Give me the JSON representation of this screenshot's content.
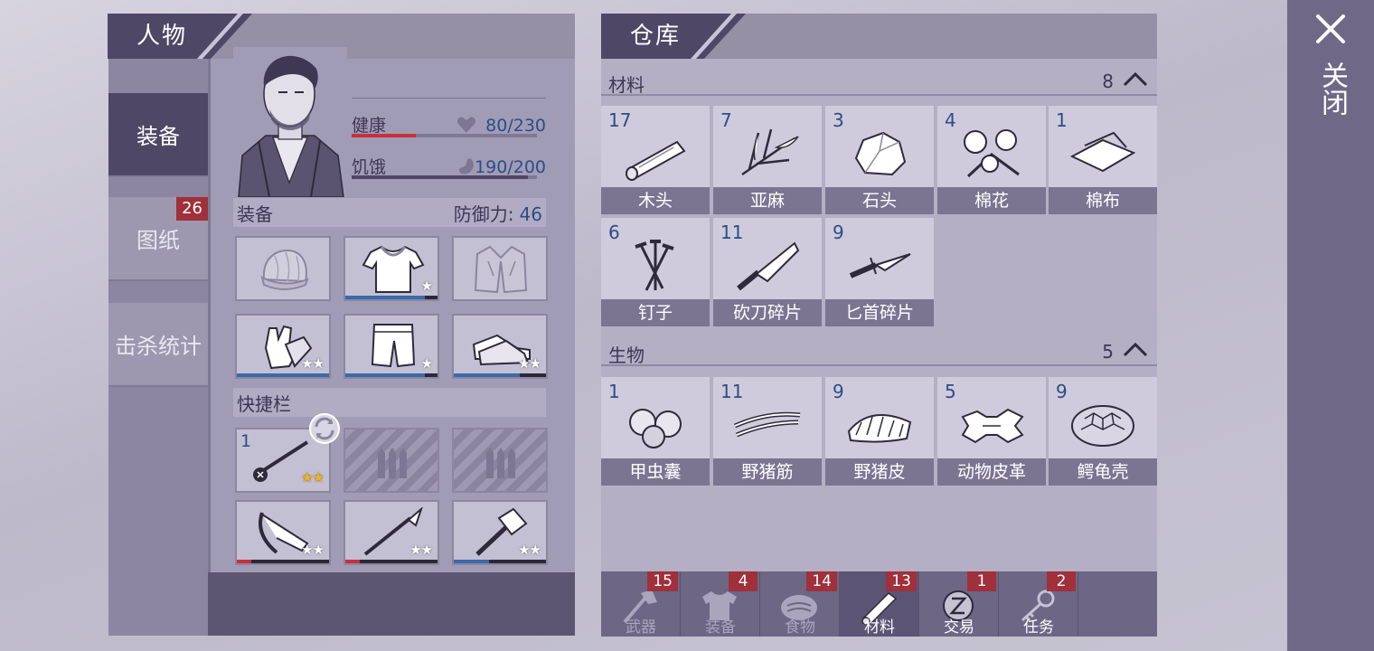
{
  "close": {
    "label": "关闭",
    "icon": "close-icon"
  },
  "character": {
    "title": "人物",
    "side_tabs": [
      {
        "label": "装备",
        "active": true
      },
      {
        "label": "图纸",
        "badge": "26"
      },
      {
        "label": "击杀统计"
      }
    ],
    "stats": {
      "health": {
        "label": "健康",
        "value": "80/230",
        "fraction": 0.348,
        "color": "#c8303a",
        "icon": "heart-icon"
      },
      "hunger": {
        "label": "饥饿",
        "value": "190/200",
        "fraction": 0.95,
        "color": "#4e4766",
        "icon": "stomach-icon"
      }
    },
    "equipment": {
      "label": "装备",
      "defense_label": "防御力:",
      "defense_value": "46",
      "slots": [
        {
          "icon": "beanie-hat-icon",
          "stars": "",
          "durability": null
        },
        {
          "icon": "shirt-icon",
          "stars": "★",
          "durability": 0.86
        },
        {
          "icon": "jacket-icon",
          "stars": "",
          "durability": null
        },
        {
          "icon": "gloves-icon",
          "stars": "★★",
          "durability": 1.0
        },
        {
          "icon": "pants-icon",
          "stars": "★",
          "durability": 0.86
        },
        {
          "icon": "sneakers-icon",
          "stars": "★★",
          "durability": 0.72
        }
      ]
    },
    "quickbar": {
      "label": "快捷栏",
      "slots": [
        {
          "qty": "1",
          "icon": "flail-weapon-icon",
          "stars": "★★",
          "locked": false
        },
        {
          "icon": "locked-slot-icon",
          "locked": true
        },
        {
          "icon": "locked-slot-icon",
          "locked": true
        },
        {
          "icon": "crossbow-icon",
          "stars": "★★",
          "durability": 0.16,
          "dur_color": "#c8303a"
        },
        {
          "icon": "spear-icon",
          "stars": "★★",
          "durability": 0.16,
          "dur_color": "#c8303a"
        },
        {
          "icon": "sledgehammer-icon",
          "stars": "★★",
          "durability": 0.38
        }
      ]
    }
  },
  "storage": {
    "title": "仓库",
    "categories": [
      {
        "label": "材料",
        "count": "8",
        "items": [
          {
            "qty": "17",
            "name": "木头",
            "icon": "wood-log-icon"
          },
          {
            "qty": "7",
            "name": "亚麻",
            "icon": "flax-icon"
          },
          {
            "qty": "3",
            "name": "石头",
            "icon": "stone-icon"
          },
          {
            "qty": "4",
            "name": "棉花",
            "icon": "cotton-icon"
          },
          {
            "qty": "1",
            "name": "棉布",
            "icon": "cloth-icon"
          },
          {
            "qty": "6",
            "name": "钉子",
            "icon": "nails-icon"
          },
          {
            "qty": "11",
            "name": "砍刀碎片",
            "icon": "machete-fragment-icon"
          },
          {
            "qty": "9",
            "name": "匕首碎片",
            "icon": "dagger-fragment-icon"
          }
        ]
      },
      {
        "label": "生物",
        "count": "5",
        "items": [
          {
            "qty": "1",
            "name": "甲虫囊",
            "icon": "beetle-sac-icon"
          },
          {
            "qty": "11",
            "name": "野猪筋",
            "icon": "boar-sinew-icon"
          },
          {
            "qty": "9",
            "name": "野猪皮",
            "icon": "boar-hide-icon"
          },
          {
            "qty": "5",
            "name": "动物皮革",
            "icon": "leather-icon"
          },
          {
            "qty": "9",
            "name": "鳄龟壳",
            "icon": "turtle-shell-icon"
          }
        ]
      }
    ],
    "bottom_tabs": [
      {
        "label": "武器",
        "badge": "15",
        "icon": "axe-icon"
      },
      {
        "label": "装备",
        "badge": "4",
        "icon": "shirt-icon"
      },
      {
        "label": "食物",
        "badge": "14",
        "icon": "meat-icon"
      },
      {
        "label": "材料",
        "badge": "13",
        "icon": "wood-log-icon",
        "active": true
      },
      {
        "label": "交易",
        "badge": "1",
        "icon": "coin-icon"
      },
      {
        "label": "任务",
        "badge": "2",
        "icon": "key-icon"
      }
    ]
  }
}
